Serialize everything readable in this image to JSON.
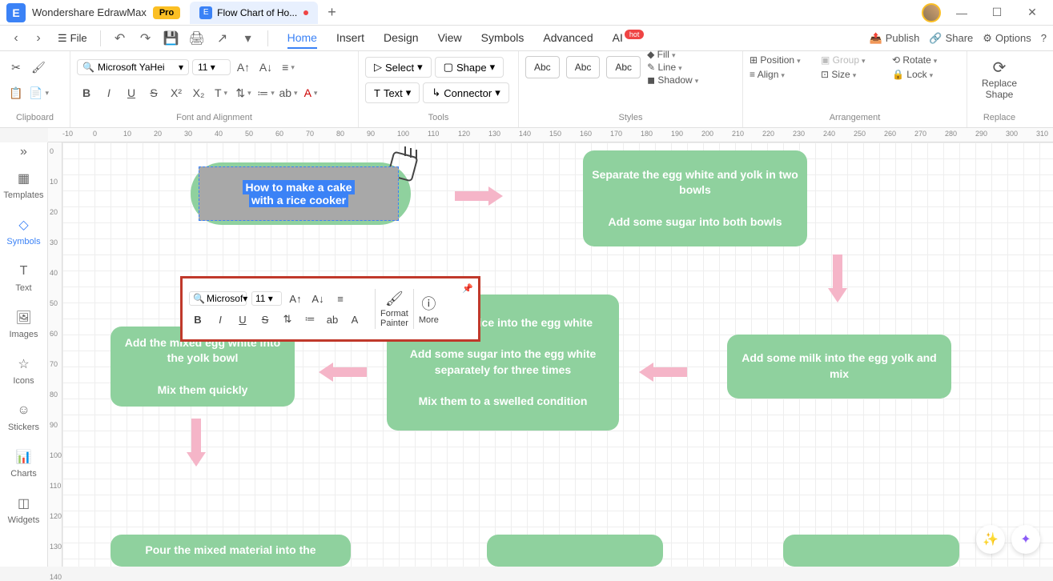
{
  "titlebar": {
    "app_name": "Wondershare EdrawMax",
    "pro": "Pro",
    "tab_title": "Flow Chart of Ho..."
  },
  "menubar": {
    "file": "File",
    "tabs": [
      "Home",
      "Insert",
      "Design",
      "View",
      "Symbols",
      "Advanced",
      "AI"
    ],
    "ai_badge": "hot",
    "publish": "Publish",
    "share": "Share",
    "options": "Options"
  },
  "ribbon": {
    "clipboard": "Clipboard",
    "font_align": "Font and Alignment",
    "tools": "Tools",
    "styles": "Styles",
    "arrangement": "Arrangement",
    "replace": "Replace",
    "font": "Microsoft YaHei",
    "size": "11",
    "select": "Select",
    "shape": "Shape",
    "text": "Text",
    "connector": "Connector",
    "abc": "Abc",
    "fill": "Fill",
    "line": "Line",
    "shadow": "Shadow",
    "position": "Position",
    "align": "Align",
    "group": "Group",
    "size_btn": "Size",
    "rotate": "Rotate",
    "lock": "Lock",
    "replace_shape": "Replace\nShape"
  },
  "sidebar": {
    "items": [
      {
        "label": "Templates"
      },
      {
        "label": "Symbols"
      },
      {
        "label": "Text"
      },
      {
        "label": "Images"
      },
      {
        "label": "Icons"
      },
      {
        "label": "Stickers"
      },
      {
        "label": "Charts"
      },
      {
        "label": "Widgets"
      }
    ]
  },
  "canvas": {
    "start_line1": "How to make a cake",
    "start_line2": "with a rice cooker",
    "box1": "Separate the egg white and yolk in two bowls\n\nAdd some sugar into both bowls",
    "box2": "Add some milk into the egg yolk and mix",
    "box3_l1": "me lemon juice into the egg white",
    "box3_l2": "Add some sugar into the egg white separately for three times",
    "box3_l3": "Mix them to a swelled condition",
    "box4": "Add the mixed egg white into the yolk bowl\n\nMix them quickly",
    "box5": "Pour the mixed material into the"
  },
  "float": {
    "font": "Microsof",
    "size": "11",
    "format_painter": "Format\nPainter",
    "more": "More"
  },
  "ruler_h": [
    "-10",
    "0",
    "10",
    "20",
    "30",
    "40",
    "50",
    "60",
    "70",
    "80",
    "90",
    "100",
    "110",
    "120",
    "130",
    "140",
    "150",
    "160",
    "170",
    "180",
    "190",
    "200",
    "210",
    "220",
    "230",
    "240",
    "250",
    "260",
    "270",
    "280",
    "290",
    "300",
    "310"
  ],
  "ruler_v": [
    "0",
    "10",
    "20",
    "30",
    "40",
    "50",
    "60",
    "70",
    "80",
    "90",
    "100",
    "110",
    "120",
    "130",
    "140"
  ]
}
